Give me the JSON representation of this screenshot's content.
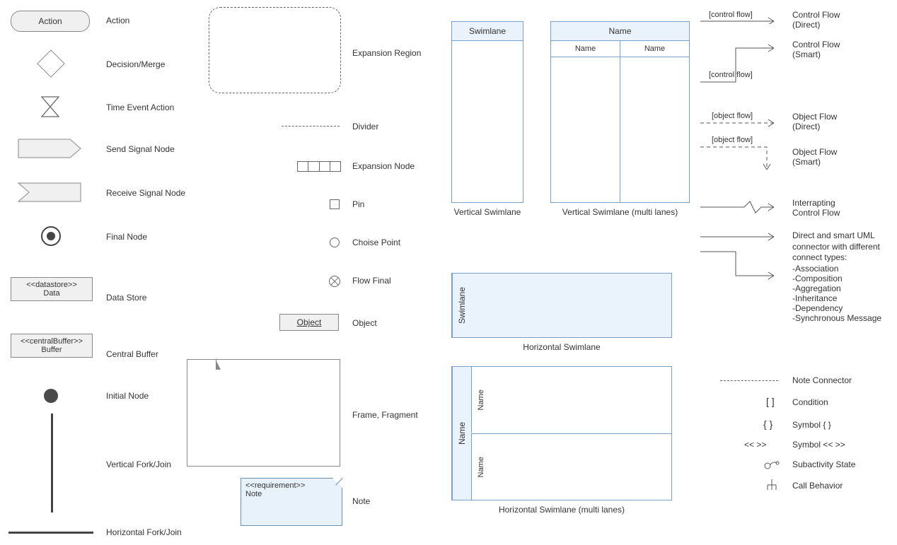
{
  "col1": {
    "action": {
      "shape_text": "Action",
      "label": "Action"
    },
    "decision": {
      "label": "Decision/Merge"
    },
    "time_event": {
      "label": "Time Event Action"
    },
    "send_signal": {
      "label": "Send Signal Node"
    },
    "receive_signal": {
      "label": "Receive Signal Node"
    },
    "final_node": {
      "label": "Final Node"
    },
    "datastore": {
      "stereo": "<<datastore>>",
      "name": "Data",
      "label": "Data Store"
    },
    "central_buffer": {
      "stereo": "<<centralBuffer>>",
      "name": "Buffer",
      "label": "Central Buffer"
    },
    "initial_node": {
      "label": "Initial Node"
    },
    "vfork": {
      "label": "Vertical Fork/Join"
    },
    "hfork": {
      "label": "Horizontal Fork/Join"
    }
  },
  "col2": {
    "expansion_region": {
      "label": "Expansion Region"
    },
    "divider": {
      "label": "Divider"
    },
    "expansion_node": {
      "label": "Expansion Node"
    },
    "pin": {
      "label": "Pin"
    },
    "choise": {
      "label": "Choise Point"
    },
    "flow_final": {
      "label": "Flow Final"
    },
    "object": {
      "shape_text": "Object",
      "label": "Object"
    },
    "frame": {
      "label": "Frame, Fragment"
    },
    "note": {
      "stereo": "<<requirement>>",
      "name": "Note",
      "label": "Note"
    }
  },
  "col3": {
    "vswim": {
      "head": "Swimlane",
      "caption": "Vertical Swimlane"
    },
    "vswim_multi": {
      "head": "Name",
      "sub1": "Name",
      "sub2": "Name",
      "caption": "Vertical Swimlane (multi lanes)"
    },
    "hswim": {
      "head": "Swimlane",
      "caption": "Horizontal Swimlane"
    },
    "hswim_multi": {
      "head": "Name",
      "sub1": "Name",
      "sub2": "Name",
      "caption": "Horizontal Swimlane (multi lanes)"
    }
  },
  "col4": {
    "cf_direct": {
      "text": "[control flow]",
      "label1": "Control Flow",
      "label2": "(Direct)"
    },
    "cf_smart": {
      "text": "[control flow]",
      "label1": "Control Flow",
      "label2": "(Smart)"
    },
    "of_direct": {
      "text": "[object flow]",
      "label1": "Object Flow",
      "label2": "(Direct)"
    },
    "of_smart": {
      "text": "[object flow]",
      "label1": "Object Flow",
      "label2": "(Smart)"
    },
    "interrupt": {
      "label1": "Interrapting",
      "label2": "Control Flow"
    },
    "connector": {
      "intro": "Direct and smart UML connector with different connect types:",
      "t1": "-Association",
      "t2": "-Composition",
      "t3": "-Aggregation",
      "t4": "-Inheritance",
      "t5": "-Dependency",
      "t6": "-Synchronous Message"
    },
    "note_conn": {
      "label": "Note Connector"
    },
    "condition": {
      "sym": "[ ]",
      "label": "Condition"
    },
    "curly": {
      "sym": "{ }",
      "label": "Symbol { }"
    },
    "angle": {
      "sym": "<< >>",
      "label": "Symbol << >>"
    },
    "subactivity": {
      "label": "Subactivity State"
    },
    "call_behavior": {
      "label": "Call Behavior"
    }
  }
}
